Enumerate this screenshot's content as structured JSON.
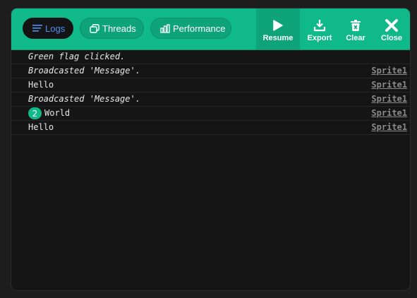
{
  "tabs": [
    {
      "label": "Logs",
      "icon": "lines-icon",
      "active": true
    },
    {
      "label": "Threads",
      "icon": "windows-icon",
      "active": false
    },
    {
      "label": "Performance",
      "icon": "bar-chart-icon",
      "active": false
    }
  ],
  "actions": [
    {
      "label": "Resume",
      "icon": "play-icon"
    },
    {
      "label": "Export",
      "icon": "download-icon"
    },
    {
      "label": "Clear",
      "icon": "trash-icon"
    },
    {
      "label": "Close",
      "icon": "close-icon"
    }
  ],
  "logs": [
    {
      "message": "Green flag clicked.",
      "italic": true,
      "source": "",
      "count": ""
    },
    {
      "message": "Broadcasted 'Message'.",
      "italic": true,
      "source": "Sprite1",
      "count": ""
    },
    {
      "message": "Hello",
      "italic": false,
      "source": "Sprite1",
      "count": ""
    },
    {
      "message": "Broadcasted 'Message'.",
      "italic": true,
      "source": "Sprite1",
      "count": ""
    },
    {
      "message": "World",
      "italic": false,
      "source": "Sprite1",
      "count": "2"
    },
    {
      "message": "Hello",
      "italic": false,
      "source": "Sprite1",
      "count": ""
    }
  ],
  "colors": {
    "accent": "#10b98a",
    "active_tab_text": "#4d8ff7",
    "background": "#151515"
  }
}
